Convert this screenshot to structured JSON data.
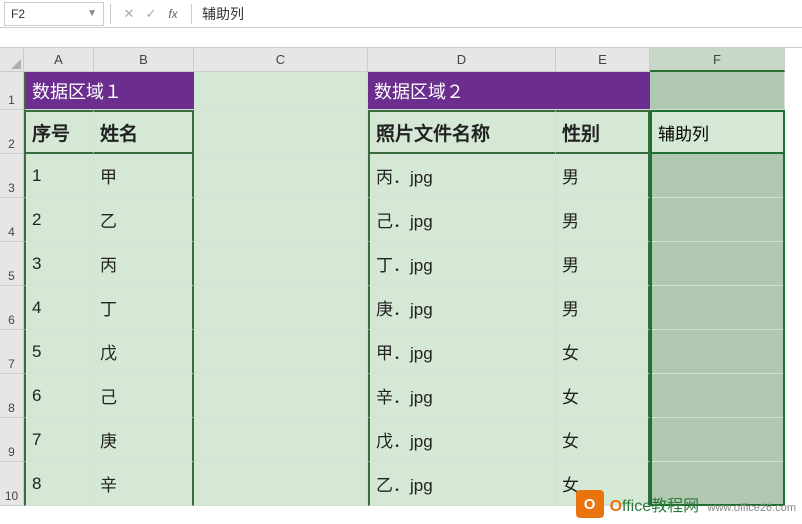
{
  "nameBox": "F2",
  "formulaValue": "辅助列",
  "columns": [
    "A",
    "B",
    "C",
    "D",
    "E",
    "F"
  ],
  "rows": [
    "1",
    "2",
    "3",
    "4",
    "5",
    "6",
    "7",
    "8",
    "9",
    "10"
  ],
  "region1": {
    "title": "数据区域１"
  },
  "region2": {
    "title": "数据区域２"
  },
  "headers": {
    "seq": "序号",
    "name": "姓名",
    "photo": "照片文件名称",
    "gender": "性别",
    "helper": "辅助列"
  },
  "data1": [
    {
      "seq": "1",
      "name": "甲"
    },
    {
      "seq": "2",
      "name": "乙"
    },
    {
      "seq": "3",
      "name": "丙"
    },
    {
      "seq": "4",
      "name": "丁"
    },
    {
      "seq": "5",
      "name": "戊"
    },
    {
      "seq": "6",
      "name": "己"
    },
    {
      "seq": "7",
      "name": "庚"
    },
    {
      "seq": "8",
      "name": "辛"
    }
  ],
  "data2": [
    {
      "photo": "丙．jpg",
      "gender": "男"
    },
    {
      "photo": "己．jpg",
      "gender": "男"
    },
    {
      "photo": "丁．jpg",
      "gender": "男"
    },
    {
      "photo": "庚．jpg",
      "gender": "男"
    },
    {
      "photo": "甲．jpg",
      "gender": "女"
    },
    {
      "photo": "辛．jpg",
      "gender": "女"
    },
    {
      "photo": "戊．jpg",
      "gender": "女"
    },
    {
      "photo": "乙．jpg",
      "gender": "女"
    }
  ],
  "watermark": {
    "brandO": "O",
    "brandRest": "ffice教程网",
    "url": "www.office26.com"
  }
}
